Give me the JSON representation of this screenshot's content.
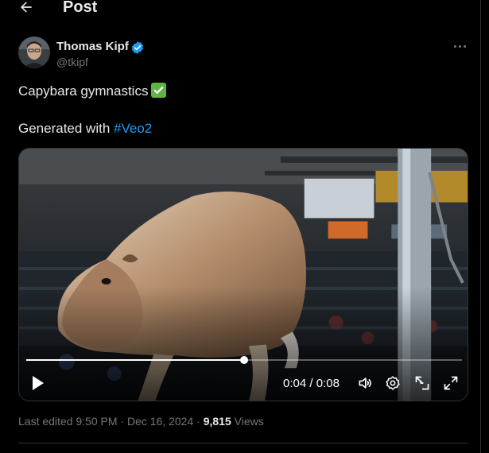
{
  "header": {
    "title": "Post",
    "back_icon": "arrow-left-icon"
  },
  "author": {
    "name": "Thomas Kipf",
    "handle": "@tkipf",
    "verified": true,
    "verified_color": "#1d9bf0"
  },
  "tweet": {
    "line1": "Capybara gymnastics",
    "line1_emoji": "check-mark-button-emoji",
    "line2_prefix": "Generated with ",
    "hashtag": "#Veo2"
  },
  "video": {
    "current_time": "0:04",
    "separator": " / ",
    "duration": "0:08",
    "progress_fraction": 0.5,
    "controls": [
      "play-icon",
      "volume-icon",
      "settings-icon",
      "pip-icon",
      "fullscreen-icon"
    ]
  },
  "meta": {
    "edited_text": "Last edited 9:50 PM · Dec 16, 2024 · ",
    "views_count": "9,815",
    "views_label": " Views"
  },
  "colors": {
    "background": "#000000",
    "text": "#e7e9ea",
    "muted": "#71767b",
    "accent": "#1d9bf0",
    "divider": "#2f3336"
  }
}
